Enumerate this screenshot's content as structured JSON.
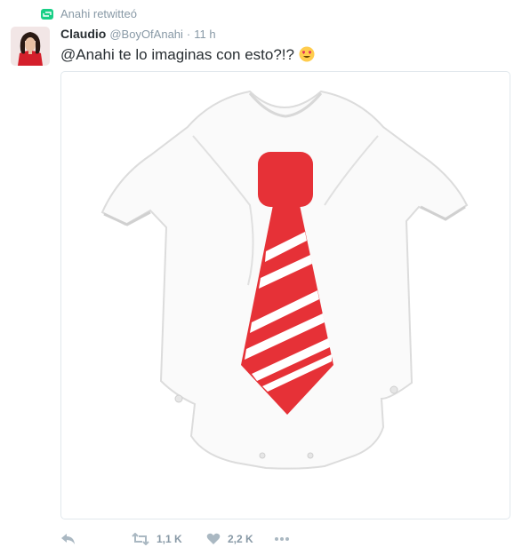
{
  "retweet_context": {
    "text": "Anahi retwitteó",
    "icon": "retweet-icon",
    "color": "#19cf86"
  },
  "tweet": {
    "name": "Claudio",
    "handle": "@BoyOfAnahi",
    "separator": "·",
    "time": "11 h",
    "text": "@Anahi te lo imaginas con esto?!?",
    "emoji": "heart-eyes-emoji"
  },
  "actions": {
    "reply_icon": "reply-icon",
    "retweet_icon": "retweet-icon",
    "retweet_count": "1,1 K",
    "like_icon": "heart-icon",
    "like_count": "2,2 K",
    "more_icon": "more-icon"
  },
  "colors": {
    "muted": "#8899a6",
    "icon": "#aab8c2",
    "tie_red": "#e63137"
  }
}
